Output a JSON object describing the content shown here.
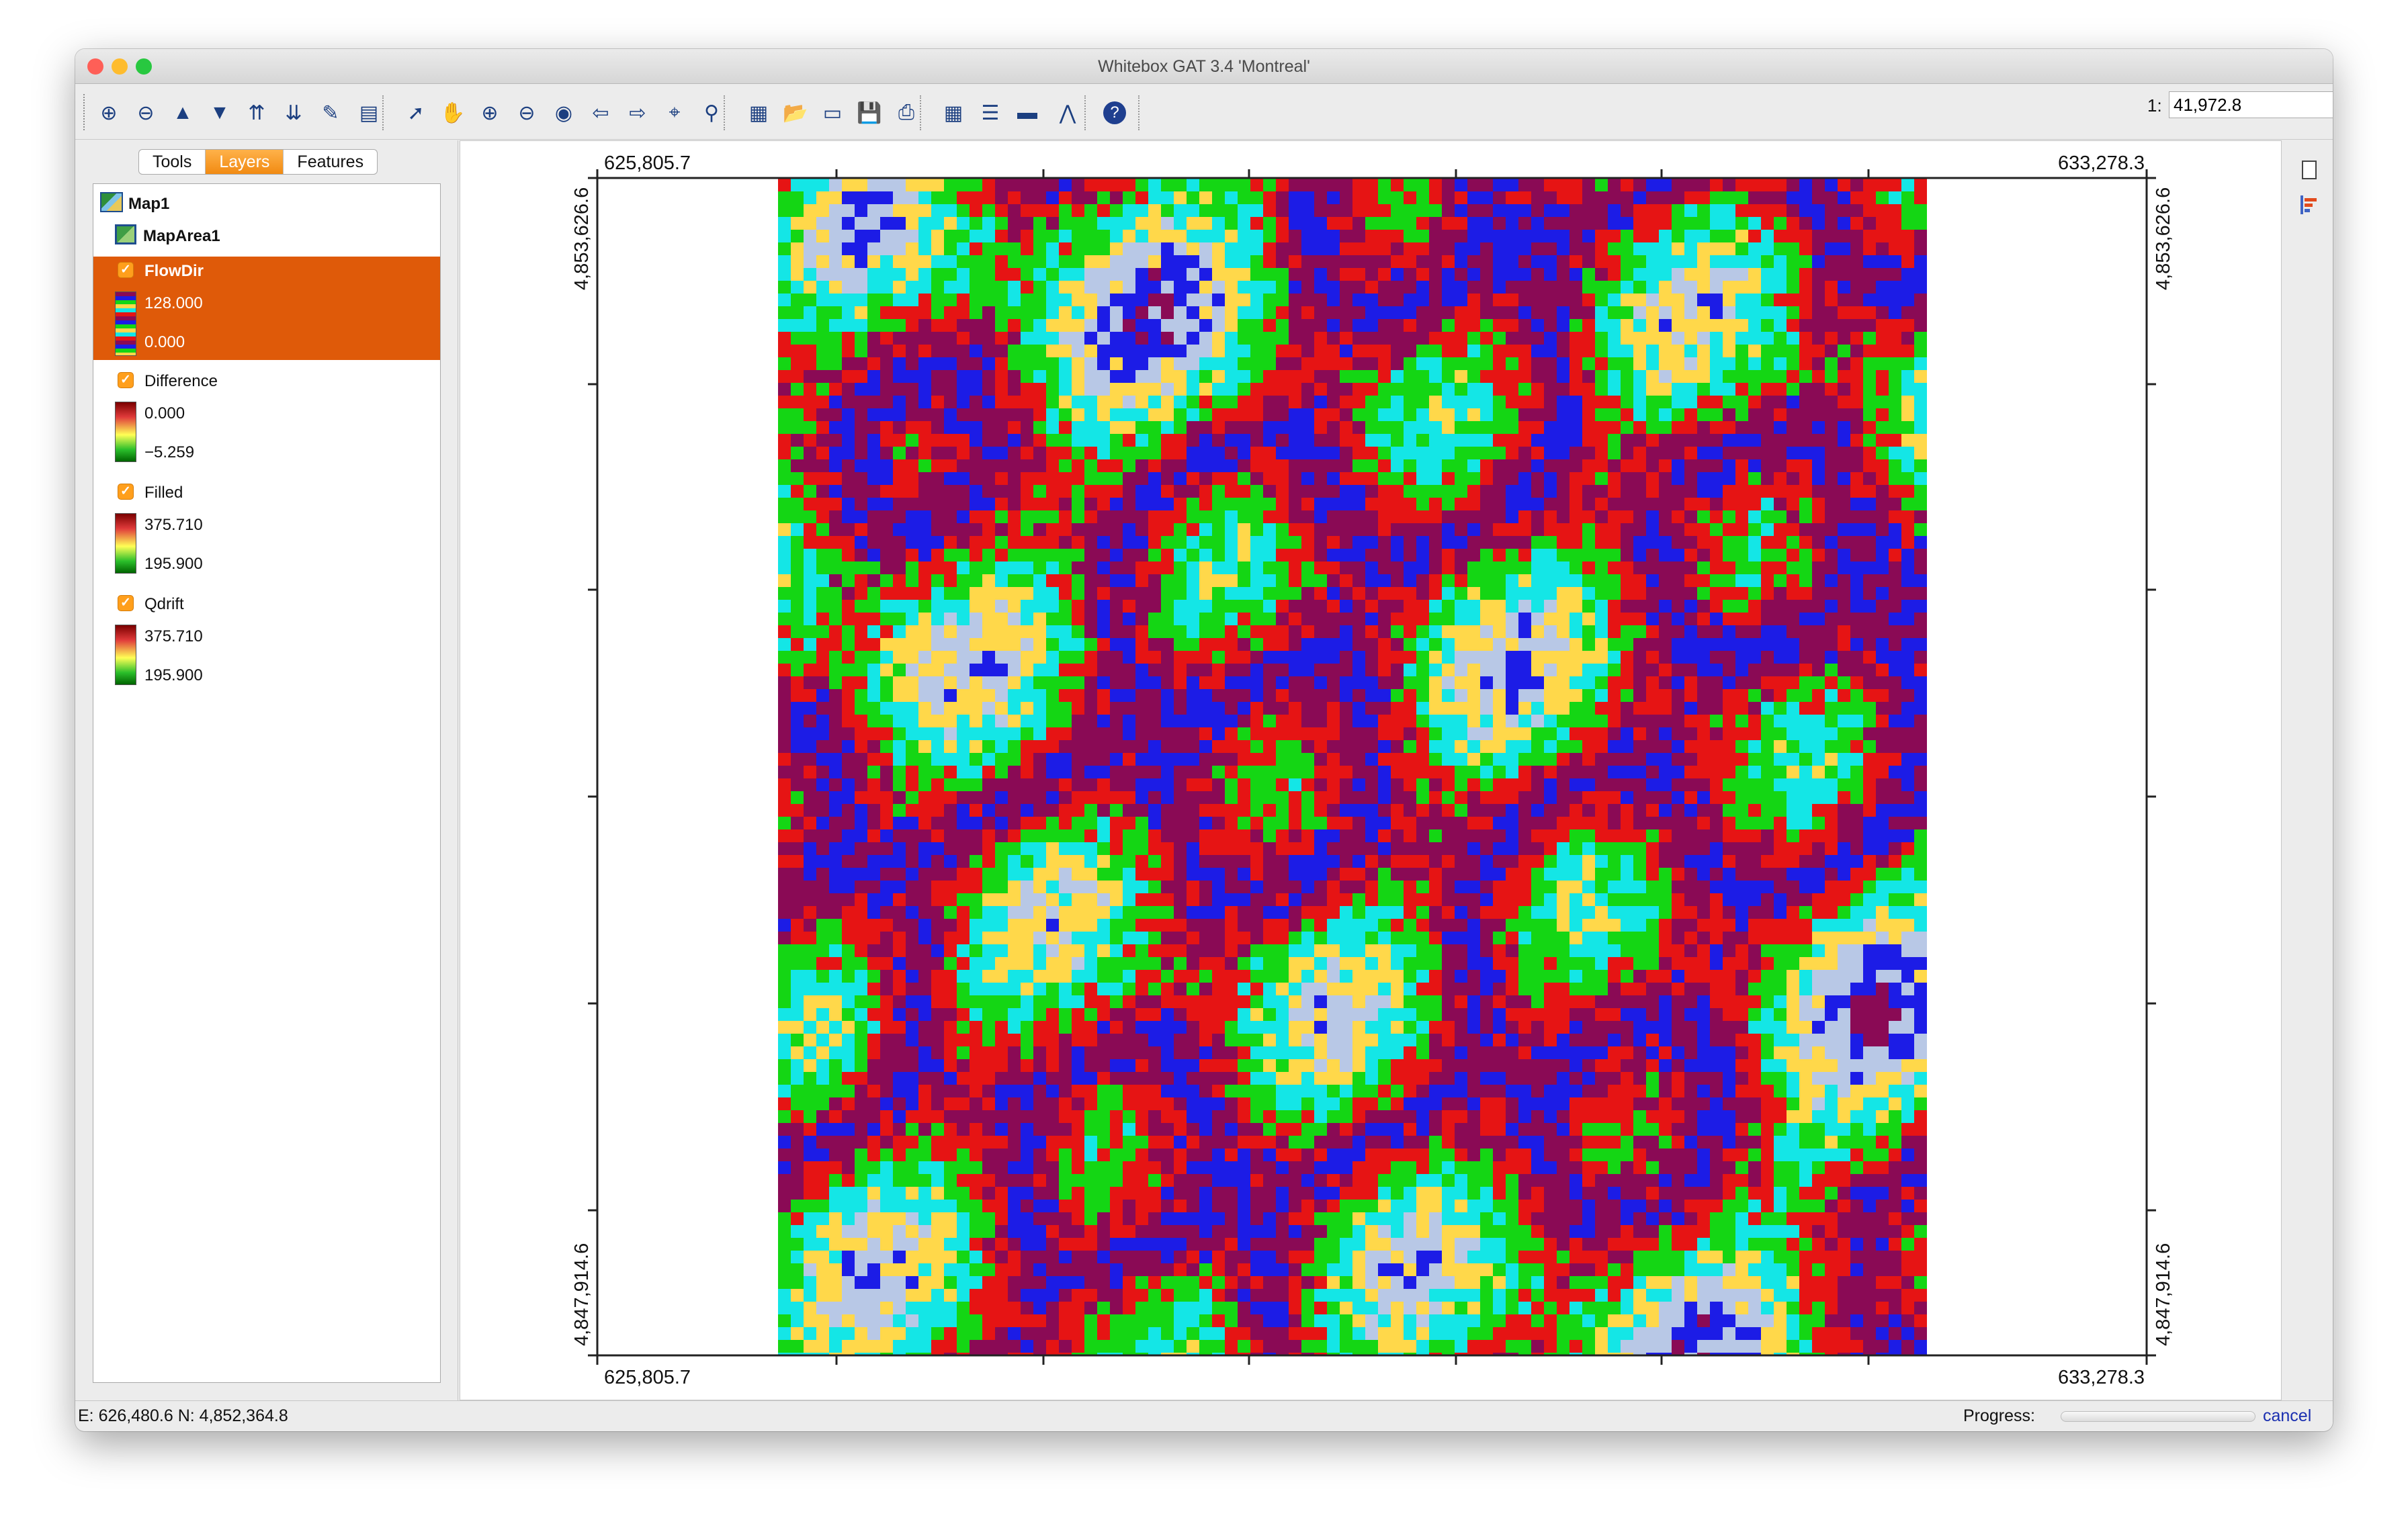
{
  "window": {
    "title": "Whitebox GAT 3.4 'Montreal'",
    "traffic_colors": [
      "#fe5f57",
      "#febc2e",
      "#28c840"
    ]
  },
  "toolbar": {
    "buttons": [
      {
        "icon": "add-layer-icon"
      },
      {
        "icon": "remove-layer-icon"
      },
      {
        "icon": "raise-layer-icon"
      },
      {
        "icon": "lower-layer-icon"
      },
      {
        "icon": "layer-to-top-icon"
      },
      {
        "icon": "layer-to-bottom-icon"
      },
      {
        "icon": "layer-properties-icon"
      },
      {
        "icon": "attribute-table-icon"
      },
      {
        "icon": "select-feature-icon"
      },
      {
        "icon": "pan-hand-icon"
      },
      {
        "icon": "zoom-in-icon"
      },
      {
        "icon": "zoom-out-icon"
      },
      {
        "icon": "full-extent-globe-icon"
      },
      {
        "icon": "previous-extent-icon"
      },
      {
        "icon": "next-extent-icon"
      },
      {
        "icon": "zoom-to-selection-icon"
      },
      {
        "icon": "zoom-box-icon"
      },
      {
        "icon": "new-map-icon"
      },
      {
        "icon": "open-map-icon"
      },
      {
        "icon": "open-folder-icon"
      },
      {
        "icon": "save-map-icon"
      },
      {
        "icon": "print-map-icon"
      },
      {
        "icon": "calculator-icon"
      },
      {
        "icon": "scroll-icon"
      },
      {
        "icon": "measure-ruler-icon"
      },
      {
        "icon": "digitize-line-icon"
      },
      {
        "icon": "help-icon"
      }
    ],
    "scale_label": "1:",
    "scale_value": "41,972.8"
  },
  "sidebar": {
    "tabs": [
      {
        "label": "Tools",
        "active": false
      },
      {
        "label": "Layers",
        "active": true
      },
      {
        "label": "Features",
        "active": false
      }
    ],
    "map_name": "Map1",
    "map_area": "MapArea1",
    "layers": [
      {
        "name": "FlowDir",
        "max": "128.000",
        "min": "0.000",
        "selected": true,
        "checked": true
      },
      {
        "name": "Difference",
        "max": "0.000",
        "min": "−5.259",
        "selected": false,
        "checked": true
      },
      {
        "name": "Filled",
        "max": "375.710",
        "min": "195.900",
        "selected": false,
        "checked": true
      },
      {
        "name": "Qdrift",
        "max": "375.710",
        "min": "195.900",
        "selected": false,
        "checked": true
      }
    ]
  },
  "map": {
    "x_min_label": "625,805.7",
    "x_max_label": "633,278.3",
    "y_max_label": "4,853,626.6",
    "y_min_label": "4,847,914.6",
    "palette": [
      "#1c1ce6",
      "#8a0a55",
      "#e61414",
      "#14d614",
      "#14e6e6",
      "#ffd84a",
      "#b8c8e6"
    ]
  },
  "status": {
    "coords": "E: 626,480.6  N: 4,852,364.8",
    "progress_label": "Progress:",
    "cancel_label": "cancel"
  },
  "rightbar": {
    "icons": [
      "document-icon",
      "legend-icon"
    ]
  }
}
